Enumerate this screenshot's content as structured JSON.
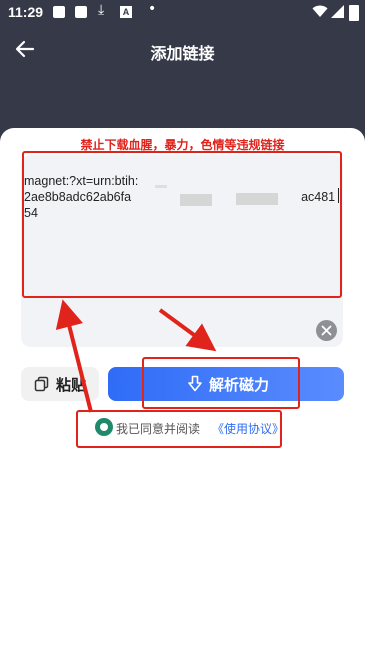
{
  "status_bar": {
    "time": "11:29"
  },
  "header": {
    "title": "添加链接"
  },
  "warning_text": "禁止下载血腥，暴力，色情等违规链接",
  "magnet_input": {
    "line1": "magnet:?xt=urn:btih:",
    "line2_start": "2ae8b8adc62ab6fa",
    "line2_end": "ac48154"
  },
  "buttons": {
    "paste_label": "粘贴",
    "parse_label": "解析磁力"
  },
  "agreement": {
    "text": "我已同意并阅读",
    "link": "《使用协议》",
    "checked": true
  },
  "colors": {
    "header_bg": "#363948",
    "warning": "#e0231b",
    "primary": "#2f6cf6",
    "radio": "#1f8a6b",
    "annotation": "#e0231b"
  },
  "icons": [
    "back-arrow-icon",
    "clear-icon",
    "paste-icon",
    "download-arrow-icon",
    "wifi-icon",
    "signal-icon",
    "battery-icon"
  ]
}
